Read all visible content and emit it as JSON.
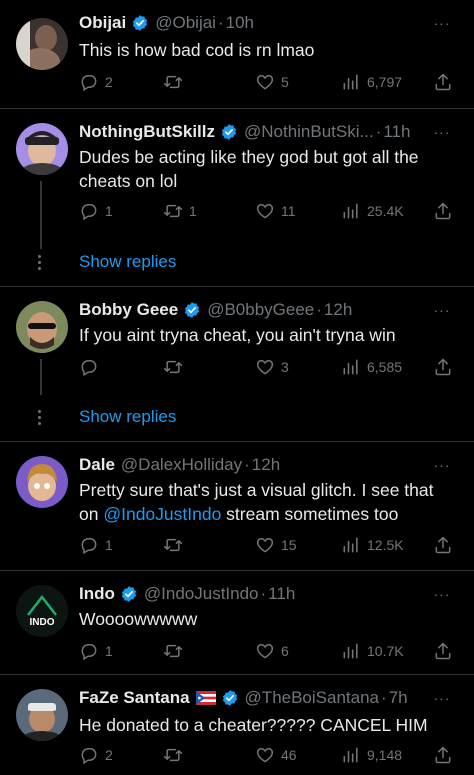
{
  "posts": [
    {
      "name": "Obijai",
      "verified": true,
      "handle": "@Obijai",
      "time": "10h",
      "text": "This is how bad cod is rn lmao",
      "replies": "2",
      "reposts": "",
      "likes": "5",
      "views": "6,797",
      "avatar_color": "#6b5a4a"
    },
    {
      "name": "NothingButSkillz",
      "verified": true,
      "handle": "@NothinButSki...",
      "time": "11h",
      "text": "Dudes be acting like they god but got all the cheats on lol",
      "replies": "1",
      "reposts": "1",
      "likes": "11",
      "views": "25.4K",
      "avatar_color": "#8a6fd6"
    },
    {
      "name": "Bobby Geee",
      "verified": true,
      "handle": "@B0bbyGeee",
      "time": "12h",
      "text": "If you aint tryna cheat, you ain't tryna win",
      "replies": "",
      "reposts": "",
      "likes": "3",
      "views": "6,585",
      "avatar_color": "#6d7a52"
    },
    {
      "name": "Dale",
      "verified": false,
      "handle": "@DalexHolliday",
      "time": "12h",
      "text_before": "Pretty sure that's just a visual glitch. I see that on ",
      "mention": "@IndoJustIndo",
      "text_after": " stream sometimes too",
      "replies": "1",
      "reposts": "",
      "likes": "15",
      "views": "12.5K",
      "avatar_color": "#7a5bc7"
    },
    {
      "name": "Indo",
      "verified": true,
      "handle": "@IndoJustIndo",
      "time": "11h",
      "text": "Woooowwwww",
      "replies": "1",
      "reposts": "",
      "likes": "6",
      "views": "10.7K",
      "avatar_label": "INDO",
      "avatar_color": "#0d1512"
    },
    {
      "name": "FaZe Santana",
      "verified": true,
      "flag": "puerto-rico-flag",
      "handle": "@TheBoiSantana",
      "time": "7h",
      "text": "He donated to a cheater????? CANCEL HIM",
      "replies": "2",
      "reposts": "",
      "likes": "46",
      "views": "9,148",
      "avatar_color": "#4a5a6a"
    }
  ],
  "show_replies_label": "Show replies",
  "colors": {
    "background": "#000000",
    "text": "#e7e9ea",
    "muted": "#71767b",
    "accent": "#1d9bf0",
    "divider": "#2f3336"
  },
  "icons": {
    "reply": "reply-icon",
    "repost": "repost-icon",
    "like": "like-icon",
    "views": "views-icon",
    "share": "share-icon",
    "verified": "verified-badge-icon",
    "more": "more-options-icon"
  }
}
